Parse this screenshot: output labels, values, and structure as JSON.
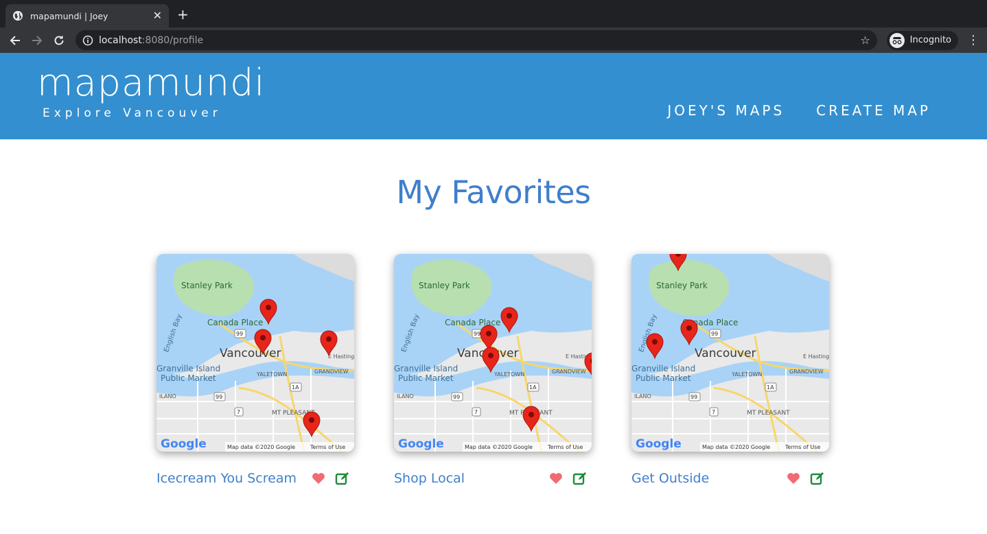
{
  "browser": {
    "tab_title": "mapamundi | Joey",
    "url_host": "localhost",
    "url_rest": ":8080/profile",
    "incognito_label": "Incognito"
  },
  "header": {
    "brand": "mapamundi",
    "tagline": "Explore Vancouver",
    "nav": [
      "JOEY'S MAPS",
      "CREATE MAP"
    ]
  },
  "main": {
    "heading": "My Favorites",
    "cards": [
      {
        "title": "Icecream You Scream"
      },
      {
        "title": "Shop Local"
      },
      {
        "title": "Get Outside"
      }
    ]
  },
  "map_labels": {
    "stanley_park": "Stanley Park",
    "canada_place": "Canada Place",
    "english_bay": "English Bay",
    "vancouver": "Vancouver",
    "granville_island": "Granville Island",
    "public_market": "Public Market",
    "yaletown": "YALETOWN",
    "grandview": "GRANDVIEW",
    "e_hastings": "E Hasting",
    "kitsilano": "ILANO",
    "mt_pleasant": "MT PLEASANT",
    "hwy_99": "99",
    "hwy_7": "7",
    "hwy_1a": "1A",
    "google": "Google",
    "map_data": "Map data ©2020 Google",
    "terms": "Terms of Use"
  },
  "colors": {
    "header_bg": "#338fcf",
    "heading": "#3f7fcb",
    "heart": "#f06b73",
    "edit": "#1e8a3a",
    "pin": "#e8251b"
  }
}
